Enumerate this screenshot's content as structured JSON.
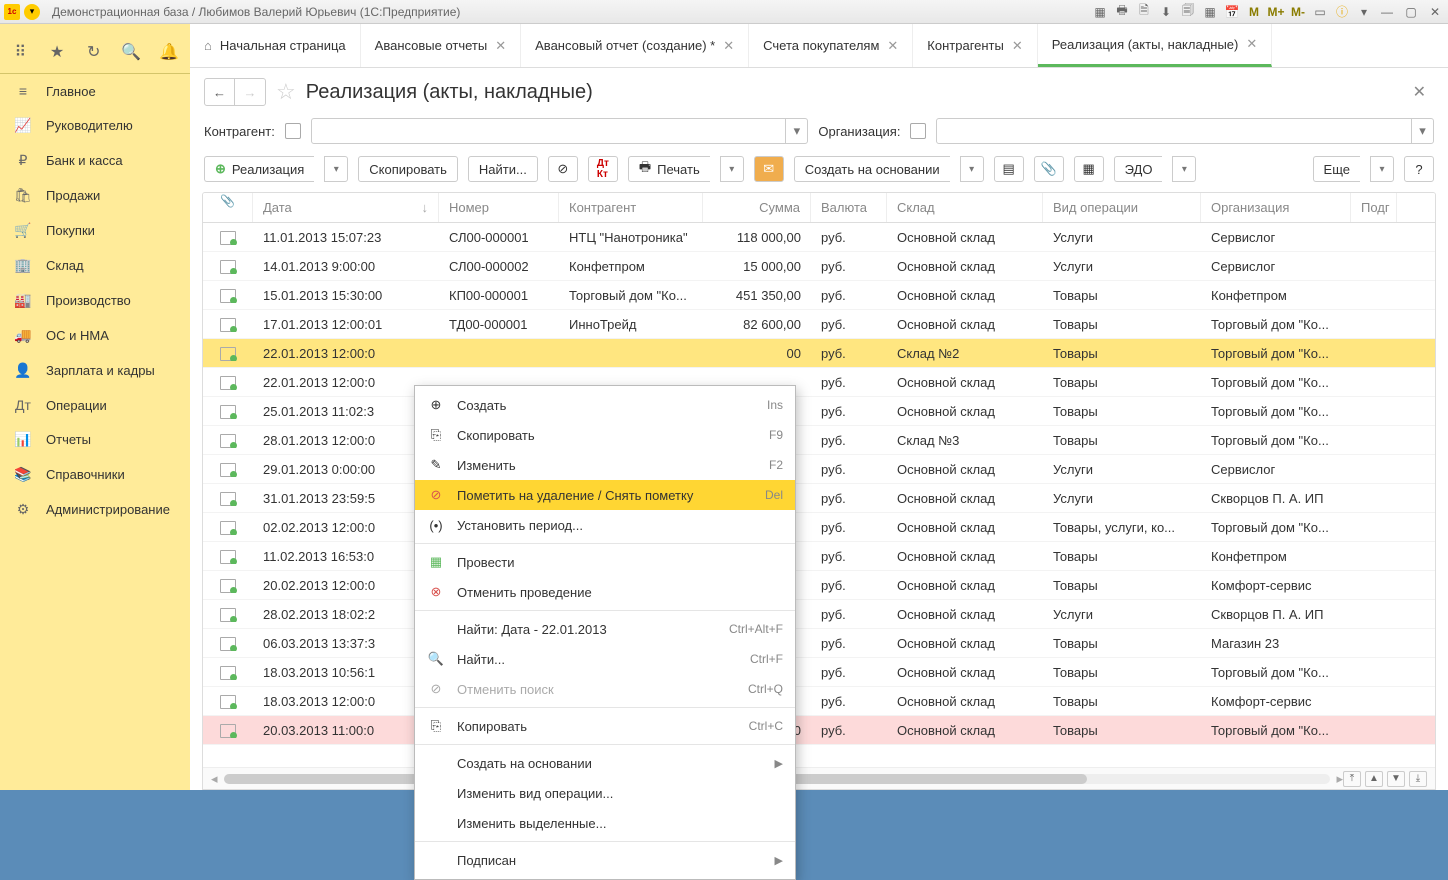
{
  "titlebar": {
    "title": "Демонстрационная база / Любимов Валерий Юрьевич  (1С:Предприятие)",
    "m_buttons": [
      "M",
      "M+",
      "M-"
    ]
  },
  "sidebar": [
    {
      "icon": "≡",
      "label": "Главное"
    },
    {
      "icon": "📈",
      "label": "Руководителю"
    },
    {
      "icon": "₽",
      "label": "Банк и касса"
    },
    {
      "icon": "🛍",
      "label": "Продажи"
    },
    {
      "icon": "🛒",
      "label": "Покупки"
    },
    {
      "icon": "🏢",
      "label": "Склад"
    },
    {
      "icon": "🏭",
      "label": "Производство"
    },
    {
      "icon": "🚚",
      "label": "ОС и НМА"
    },
    {
      "icon": "👤",
      "label": "Зарплата и кадры"
    },
    {
      "icon": "Дт",
      "label": "Операции"
    },
    {
      "icon": "📊",
      "label": "Отчеты"
    },
    {
      "icon": "📚",
      "label": "Справочники"
    },
    {
      "icon": "⚙",
      "label": "Администрирование"
    }
  ],
  "tabs": [
    {
      "label": "Начальная страница",
      "home": true,
      "closable": false
    },
    {
      "label": "Авансовые отчеты",
      "closable": true
    },
    {
      "label": "Авансовый отчет (создание) *",
      "closable": true
    },
    {
      "label": "Счета покупателям",
      "closable": true
    },
    {
      "label": "Контрагенты",
      "closable": true
    },
    {
      "label": "Реализация (акты, накладные)",
      "closable": true,
      "active": true
    }
  ],
  "page": {
    "title": "Реализация (акты, накладные)",
    "filter_contragent": "Контрагент:",
    "filter_org": "Организация:"
  },
  "toolbar": {
    "create": "Реализация",
    "copy": "Скопировать",
    "find": "Найти...",
    "print": "Печать",
    "createBase": "Создать на основании",
    "edo": "ЭДО",
    "more": "Еще"
  },
  "columns": {
    "attach": "📎",
    "date": "Дата",
    "number": "Номер",
    "contragent": "Контрагент",
    "sum": "Сумма",
    "currency": "Валюта",
    "store": "Склад",
    "operation": "Вид операции",
    "org": "Организация",
    "ext": "Подг"
  },
  "rows": [
    {
      "date": "11.01.2013 15:07:23",
      "num": "СЛ00-000001",
      "contr": "НТЦ \"Нанотроника\"",
      "sum": "118 000,00",
      "cur": "руб.",
      "store": "Основной склад",
      "op": "Услуги",
      "org": "Сервислог"
    },
    {
      "date": "14.01.2013 9:00:00",
      "num": "СЛ00-000002",
      "contr": "Конфетпром",
      "sum": "15 000,00",
      "cur": "руб.",
      "store": "Основной склад",
      "op": "Услуги",
      "org": "Сервислог"
    },
    {
      "date": "15.01.2013 15:30:00",
      "num": "КП00-000001",
      "contr": "Торговый дом \"Ко...",
      "sum": "451 350,00",
      "cur": "руб.",
      "store": "Основной склад",
      "op": "Товары",
      "org": "Конфетпром"
    },
    {
      "date": "17.01.2013 12:00:01",
      "num": "ТД00-000001",
      "contr": "ИнноТрейд",
      "sum": "82 600,00",
      "cur": "руб.",
      "store": "Основной склад",
      "op": "Товары",
      "org": "Торговый дом \"Ко..."
    },
    {
      "date": "22.01.2013 12:00:0",
      "num": "",
      "contr": "",
      "sum": "00",
      "cur": "руб.",
      "store": "Склад №2",
      "op": "Товары",
      "org": "Торговый дом \"Ко...",
      "selected": true
    },
    {
      "date": "22.01.2013 12:00:0",
      "num": "",
      "contr": "",
      "sum": "",
      "cur": "руб.",
      "store": "Основной склад",
      "op": "Товары",
      "org": "Торговый дом \"Ко..."
    },
    {
      "date": "25.01.2013 11:02:3",
      "num": "",
      "contr": "",
      "sum": "",
      "cur": "руб.",
      "store": "Основной склад",
      "op": "Товары",
      "org": "Торговый дом \"Ко..."
    },
    {
      "date": "28.01.2013 12:00:0",
      "num": "",
      "contr": "",
      "sum": "",
      "cur": "руб.",
      "store": "Склад №3",
      "op": "Товары",
      "org": "Торговый дом \"Ко..."
    },
    {
      "date": "29.01.2013 0:00:00",
      "num": "",
      "contr": "",
      "sum": "",
      "cur": "руб.",
      "store": "Основной склад",
      "op": "Услуги",
      "org": "Сервислог"
    },
    {
      "date": "31.01.2013 23:59:5",
      "num": "",
      "contr": "",
      "sum": "",
      "cur": "руб.",
      "store": "Основной склад",
      "op": "Услуги",
      "org": "Скворцов П. А. ИП"
    },
    {
      "date": "02.02.2013 12:00:0",
      "num": "",
      "contr": "",
      "sum": "",
      "cur": "руб.",
      "store": "Основной склад",
      "op": "Товары, услуги, ко...",
      "org": "Торговый дом \"Ко..."
    },
    {
      "date": "11.02.2013 16:53:0",
      "num": "",
      "contr": "",
      "sum": "",
      "cur": "руб.",
      "store": "Основной склад",
      "op": "Товары",
      "org": "Конфетпром"
    },
    {
      "date": "20.02.2013 12:00:0",
      "num": "",
      "contr": "",
      "sum": "",
      "cur": "руб.",
      "store": "Основной склад",
      "op": "Товары",
      "org": "Комфорт-сервис"
    },
    {
      "date": "28.02.2013 18:02:2",
      "num": "",
      "contr": "",
      "sum": "",
      "cur": "руб.",
      "store": "Основной склад",
      "op": "Услуги",
      "org": "Скворцов П. А. ИП"
    },
    {
      "date": "06.03.2013 13:37:3",
      "num": "",
      "contr": "",
      "sum": "",
      "cur": "руб.",
      "store": "Основной склад",
      "op": "Товары",
      "org": "Магазин 23"
    },
    {
      "date": "18.03.2013 10:56:1",
      "num": "",
      "contr": "",
      "sum": "",
      "cur": "руб.",
      "store": "Основной склад",
      "op": "Товары",
      "org": "Торговый дом \"Ко..."
    },
    {
      "date": "18.03.2013 12:00:0",
      "num": "",
      "contr": "",
      "sum": "",
      "cur": "руб.",
      "store": "Основной склад",
      "op": "Товары",
      "org": "Комфорт-сервис"
    },
    {
      "date": "20.03.2013 11:00:0",
      "num": "",
      "contr": "",
      "sum": "00",
      "cur": "руб.",
      "store": "Основной склад",
      "op": "Товары",
      "org": "Торговый дом \"Ко...",
      "pink": true
    }
  ],
  "context_menu": [
    {
      "icon": "⊕",
      "label": "Создать",
      "key": "Ins",
      "iconClass": "plus-ic"
    },
    {
      "icon": "⎘",
      "label": "Скопировать",
      "key": "F9"
    },
    {
      "icon": "✎",
      "label": "Изменить",
      "key": "F2"
    },
    {
      "icon": "⊘",
      "label": "Пометить на удаление / Снять пометку",
      "key": "Del",
      "highlighted": true,
      "iconColor": "#d9534f"
    },
    {
      "icon": "(•)",
      "label": "Установить период..."
    },
    {
      "sep": true
    },
    {
      "icon": "▦",
      "label": "Провести",
      "iconColor": "#5cb85c"
    },
    {
      "icon": "⊗",
      "label": "Отменить проведение",
      "iconColor": "#d9534f"
    },
    {
      "sep": true
    },
    {
      "icon": "",
      "label": "Найти: Дата - 22.01.2013",
      "key": "Ctrl+Alt+F"
    },
    {
      "icon": "🔍",
      "label": "Найти...",
      "key": "Ctrl+F"
    },
    {
      "icon": "⊘",
      "label": "Отменить поиск",
      "key": "Ctrl+Q",
      "disabled": true
    },
    {
      "sep": true
    },
    {
      "icon": "⎘",
      "label": "Копировать",
      "key": "Ctrl+C"
    },
    {
      "sep": true
    },
    {
      "icon": "",
      "label": "Создать на основании",
      "sub": true
    },
    {
      "icon": "",
      "label": "Изменить вид операции..."
    },
    {
      "icon": "",
      "label": "Изменить выделенные..."
    },
    {
      "sep": true
    },
    {
      "icon": "",
      "label": "Подписан",
      "sub": true
    }
  ]
}
